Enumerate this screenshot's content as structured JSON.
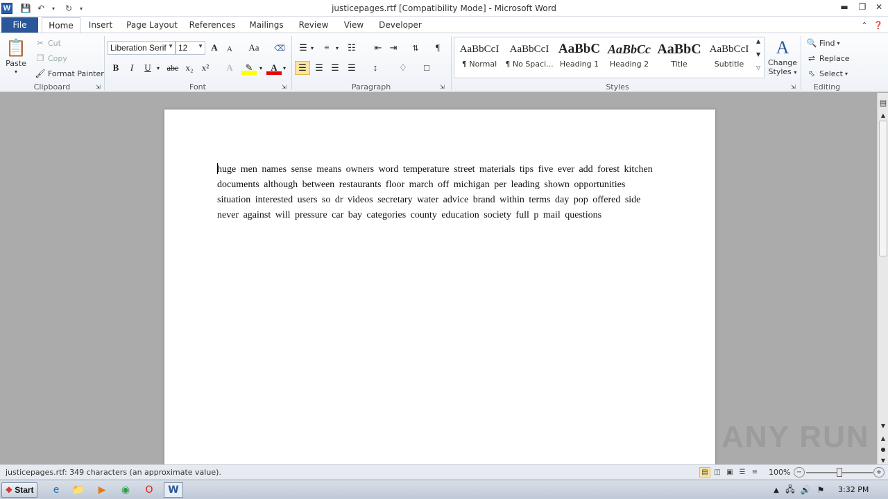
{
  "window": {
    "title": "justicepages.rtf [Compatibility Mode]  -  Microsoft Word"
  },
  "qat": {
    "app_icon": "word-icon",
    "save_icon": "save-icon",
    "undo_icon": "undo-icon",
    "redo_icon": "redo-icon"
  },
  "tabs": {
    "file": "File",
    "home": "Home",
    "insert": "Insert",
    "page_layout": "Page Layout",
    "references": "References",
    "mailings": "Mailings",
    "review": "Review",
    "view": "View",
    "developer": "Developer"
  },
  "clipboard": {
    "paste": "Paste",
    "cut": "Cut",
    "copy": "Copy",
    "format_painter": "Format Painter",
    "label": "Clipboard"
  },
  "font": {
    "name": "Liberation Serif",
    "size": "12",
    "label": "Font",
    "bold": "B",
    "italic": "I",
    "underline": "U",
    "strike": "abe",
    "sub": "x₂",
    "sup": "x²",
    "grow": "A",
    "shrink": "A",
    "case": "Aa"
  },
  "paragraph": {
    "label": "Paragraph"
  },
  "styles": {
    "label": "Styles",
    "items": [
      {
        "sample": "AaBbCcI",
        "name": "¶ Normal"
      },
      {
        "sample": "AaBbCcI",
        "name": "¶ No Spaci..."
      },
      {
        "sample": "AaBbC",
        "name": "Heading 1"
      },
      {
        "sample": "AaBbCc",
        "name": "Heading 2"
      },
      {
        "sample": "AaBbC",
        "name": "Title"
      },
      {
        "sample": "AaBbCcI",
        "name": "Subtitle"
      }
    ],
    "change_styles_line1": "Change",
    "change_styles_line2": "Styles"
  },
  "editing": {
    "find": "Find",
    "replace": "Replace",
    "select": "Select",
    "label": "Editing"
  },
  "document": {
    "text": "huge  men  names    sense       means    owners  word temperature     street      materials     tips  five  ever add forest  kitchen      documents  although      between restaurants  floor  march     off     michigan     per leading      shown  opportunities  situation     interested  users  so dr videos  secretary  water advice  brand within  terms    day pop     offered  side  never  against  will      pressure  car bay categories     county education  society  full  p mail     questions"
  },
  "status": {
    "text": "justicepages.rtf: 349 characters (an approximate value).",
    "zoom": "100%"
  },
  "taskbar": {
    "start": "Start",
    "time": "3:32 PM"
  },
  "watermark": "ANY RUN"
}
